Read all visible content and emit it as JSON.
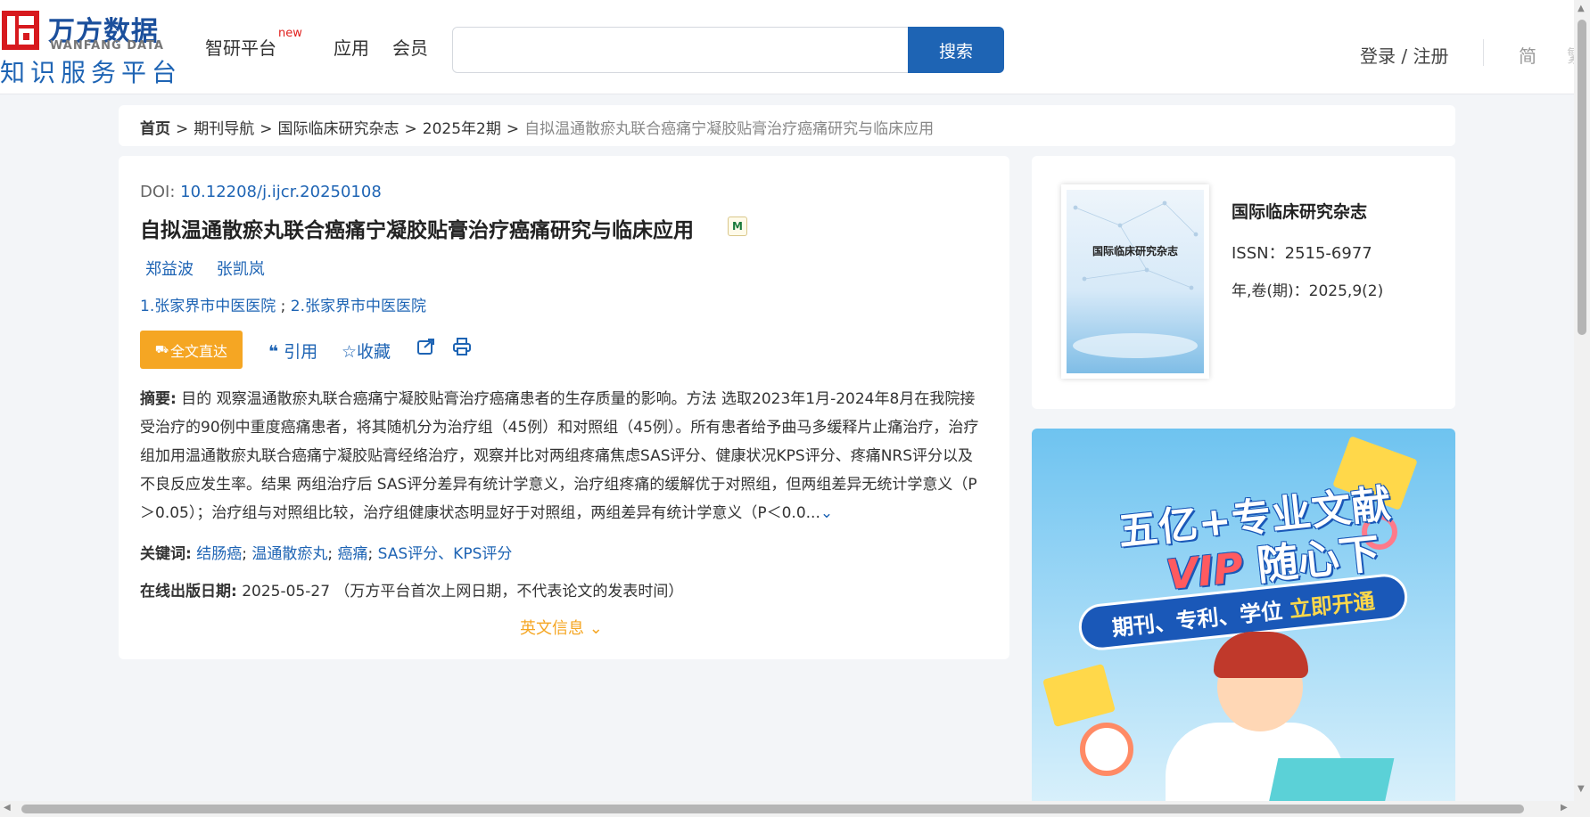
{
  "header": {
    "logo_cn": "万方数据",
    "logo_en": "WANFANG DATA",
    "logo_sub": "知识服务平台",
    "nav": [
      {
        "label": "智研平台",
        "badge": "new"
      },
      {
        "label": "应用"
      },
      {
        "label": "会员"
      }
    ],
    "search": {
      "value": "",
      "placeholder": "",
      "button": "搜索"
    },
    "login": "登录 / 注册",
    "lang_simplified": "简",
    "lang_traditional": "繁"
  },
  "breadcrumb": {
    "home": "首页",
    "items": [
      "期刊导航",
      "国际临床研究杂志",
      "2025年2期"
    ],
    "current": "自拟温通散瘀丸联合癌痛宁凝胶贴膏治疗癌痛研究与临床应用",
    "separator": ">"
  },
  "article": {
    "doi_label": "DOI: ",
    "doi": "10.12208/j.ijcr.20250108",
    "title": "自拟温通散瘀丸联合癌痛宁凝胶贴膏治疗癌痛研究与临床应用",
    "badge": "M",
    "authors": [
      "郑益波",
      "张凯岚"
    ],
    "affiliations": [
      "1.张家界市中医医院",
      "2.张家界市中医医院"
    ],
    "affil_sep": ";",
    "fulltext_button": "全文直达",
    "actions": {
      "cite": "引用",
      "favorite": "收藏"
    },
    "abstract_label": "摘要:",
    "abstract": "目的 观察温通散瘀丸联合癌痛宁凝胶贴膏治疗癌痛患者的生存质量的影响。方法 选取2023年1月-2024年8月在我院接受治疗的90例中重度癌痛患者，将其随机分为治疗组（45例）和对照组（45例）。所有患者给予曲马多缓释片止痛治疗，治疗组加用温通散瘀丸联合癌痛宁凝胶贴膏经络治疗，观察并比对两组疼痛焦虑SAS评分、健康状况KPS评分、疼痛NRS评分以及不良反应发生率。结果 两组治疗后 SAS评分差异有统计学意义，治疗组疼痛的缓解优于对照组，但两组差异无统计学意义（P＞0.05）；治疗组与对照组比较，治疗组健康状态明显好于对照组，两组差异有统计学意义（P＜0.0...",
    "keywords_label": "关键词:",
    "keywords": [
      "结肠癌",
      "温通散瘀丸",
      "癌痛",
      "SAS评分、KPS评分"
    ],
    "keyword_sep": ";",
    "pubdate_label": "在线出版日期:",
    "pubdate": "2025-05-27",
    "pubdate_note": "（万方平台首次上网日期，不代表论文的发表时间）",
    "english_info": "英文信息"
  },
  "journal": {
    "cover_title": "国际临床研究杂志",
    "name": "国际临床研究杂志",
    "issn": "ISSN：2515-6977",
    "volume": "年,卷(期)：2025,9(2)"
  },
  "ad": {
    "line1": "五亿+专业文献",
    "vip": "VIP",
    "line2_rest": " 随心下",
    "pill_text": "期刊、专利、学位",
    "pill_highlight": "立即开通"
  },
  "colors": {
    "brand_blue": "#1e64b4",
    "brand_red": "#d7191e",
    "accent_orange": "#f5a623",
    "background": "#f3f5f8"
  }
}
